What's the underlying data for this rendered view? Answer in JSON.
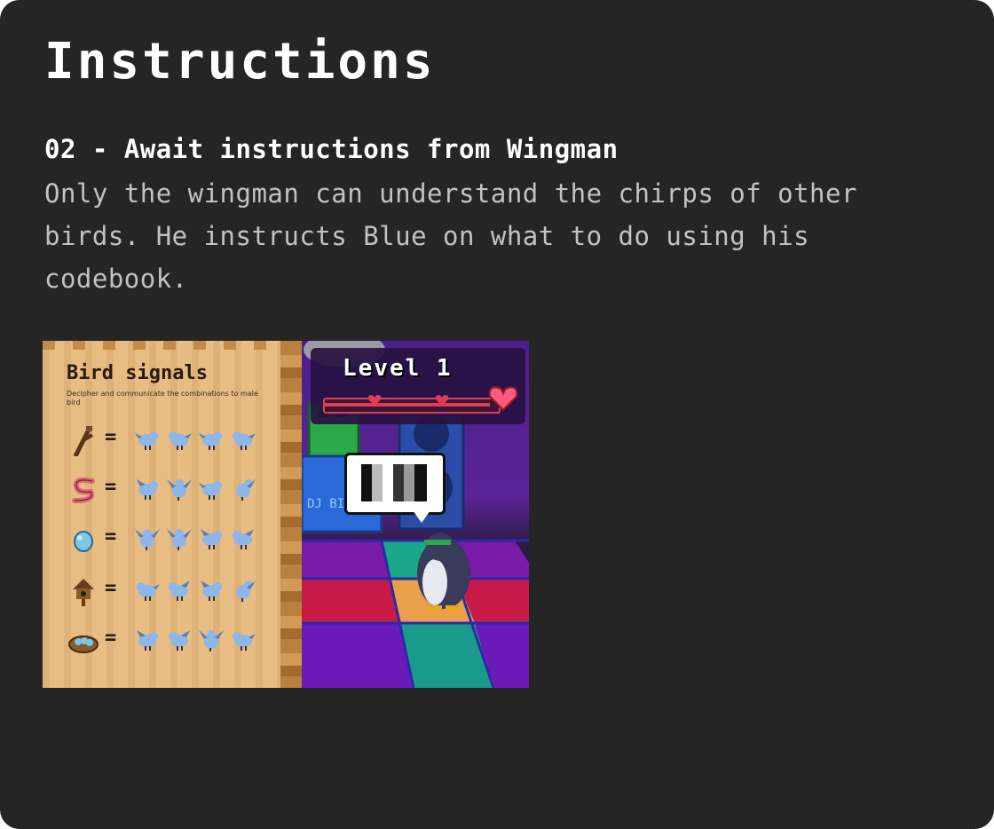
{
  "page": {
    "title": "Instructions",
    "step_title": "02 - Await instructions from Wingman",
    "step_body": "Only the wingman can understand the chirps of other birds. He instructs Blue on what to do using his codebook."
  },
  "screenshot": {
    "codebook": {
      "title": "Bird signals",
      "subtitle": "Decipher and communicate the combinations to male bird",
      "equals": "=",
      "rows": [
        {
          "icon": "twig-icon"
        },
        {
          "icon": "worm-icon"
        },
        {
          "icon": "egg-icon"
        },
        {
          "icon": "birdhouse-icon"
        },
        {
          "icon": "nest-icon"
        }
      ]
    },
    "game": {
      "level_label": "Level 1",
      "sign_text": "DJ BIRD",
      "progress": 0.95
    }
  },
  "colors": {
    "card_bg": "#252525",
    "title": "#ffffff",
    "body": "#c2c2c2",
    "parchment": "#e8bd84",
    "heart": "#e23a5b",
    "bird": "#8fb6e8"
  }
}
